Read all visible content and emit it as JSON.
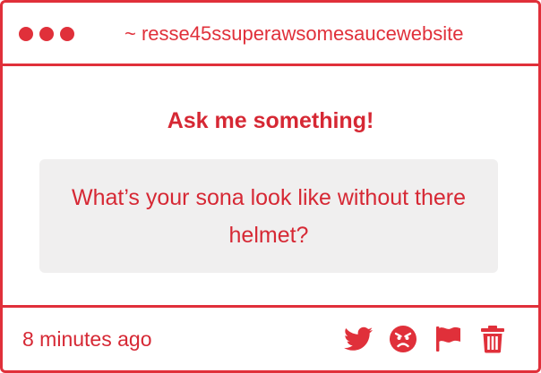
{
  "titlebar": {
    "url": "~ resse45ssuperawsomesaucewebsite"
  },
  "main": {
    "prompt": "Ask me something!",
    "question": "What’s your sona look like without there helmet?"
  },
  "footer": {
    "timestamp": "8 minutes ago",
    "icons": [
      "twitter-icon",
      "angry-face-icon",
      "flag-icon",
      "trash-icon"
    ]
  },
  "colors": {
    "accent": "#e0303a",
    "text": "#d62834",
    "question_bg": "#f0efef"
  }
}
